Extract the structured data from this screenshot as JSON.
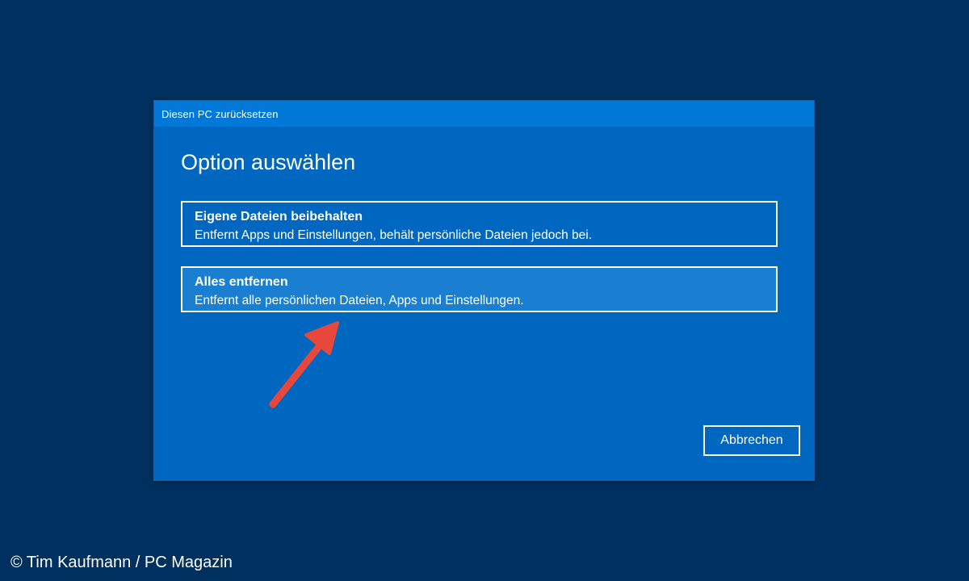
{
  "window": {
    "title": "Diesen PC zurücksetzen"
  },
  "main": {
    "heading": "Option auswählen",
    "options": [
      {
        "title": "Eigene Dateien beibehalten",
        "description": "Entfernt Apps und Einstellungen, behält persönliche Dateien jedoch bei."
      },
      {
        "title": "Alles entfernen",
        "description": "Entfernt alle persönlichen Dateien, Apps und Einstellungen."
      }
    ],
    "cancel_label": "Abbrechen"
  },
  "annotation": {
    "icon": "red-arrow-icon",
    "color": "#e8483b"
  },
  "credit": "© Tim Kaufmann / PC Magazin",
  "colors": {
    "background": "#00305f",
    "dialog": "#0067c0",
    "titlebar": "#0078d7",
    "selected_option": "#1a7fd0",
    "text": "#ffffff"
  }
}
